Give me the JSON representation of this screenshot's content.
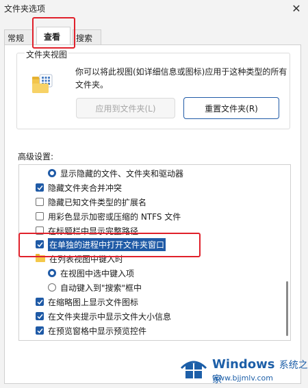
{
  "window": {
    "title": "文件夹选项"
  },
  "tabs": [
    {
      "label": "常规"
    },
    {
      "label": "查看"
    },
    {
      "label": "搜索"
    }
  ],
  "folder_views": {
    "group_title": "文件夹视图",
    "description": "你可以将此视图(如详细信息或图标)应用于这种类型的所有文件夹。",
    "apply_button": "应用到文件夹(L)",
    "reset_button": "重置文件夹(R)"
  },
  "advanced": {
    "label": "高级设置:",
    "items": [
      {
        "type": "radio",
        "checked": true,
        "label": "显示隐藏的文件、文件夹和驱动器"
      },
      {
        "type": "checkbox",
        "checked": true,
        "label": "隐藏文件夹合并冲突"
      },
      {
        "type": "checkbox",
        "checked": false,
        "label": "隐藏已知文件类型的扩展名"
      },
      {
        "type": "checkbox",
        "checked": false,
        "label": "用彩色显示加密或压缩的 NTFS 文件"
      },
      {
        "type": "checkbox",
        "checked": false,
        "label": "在标题栏中显示完整路径"
      },
      {
        "type": "checkbox",
        "checked": true,
        "label": "在单独的进程中打开文件夹窗口"
      },
      {
        "type": "folder",
        "label": "在列表视图中键入时"
      },
      {
        "type": "radio",
        "checked": true,
        "label": "在视图中选中键入项"
      },
      {
        "type": "radio",
        "checked": false,
        "label": "自动键入到\"搜索\"框中"
      },
      {
        "type": "checkbox",
        "checked": true,
        "label": "在缩略图上显示文件图标"
      },
      {
        "type": "checkbox",
        "checked": true,
        "label": "在文件夹提示中显示文件大小信息"
      },
      {
        "type": "checkbox",
        "checked": true,
        "label": "在预览窗格中显示预览控件"
      }
    ]
  },
  "watermark": {
    "brand": "Windows",
    "brand_cn": "系统之家",
    "url": "www.bjjmlv.com"
  },
  "colors": {
    "accent": "#1f5aa6",
    "annotation_red": "#e0202a"
  }
}
